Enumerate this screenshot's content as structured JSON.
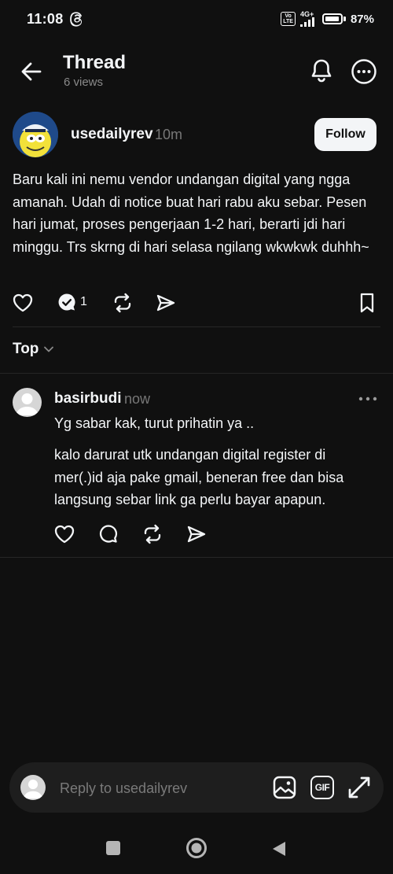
{
  "status_bar": {
    "time": "11:08",
    "volte": "Vo\nLTE",
    "network": "4G+",
    "battery": "87%",
    "battery_level": 0.87
  },
  "header": {
    "title": "Thread",
    "subtitle": "6 views"
  },
  "post": {
    "username": "usedailyrev",
    "time": "10m",
    "follow_label": "Follow",
    "text": "Baru kali ini nemu vendor undangan digital yang ngga amanah. Udah di notice buat hari rabu aku sebar. Pesen hari jumat, proses pengerjaan 1-2 hari, berarti jdi hari minggu. Trs skrng di hari selasa ngilang wkwkwk duhhh~",
    "reply_count": "1"
  },
  "sort": {
    "label": "Top"
  },
  "reply": {
    "username": "basirbudi",
    "time": "now",
    "line1": "Yg sabar kak, turut prihatin ya ..",
    "line2": "kalo darurat utk undangan digital register di mer(.)id aja pake gmail, beneran free dan bisa langsung sebar link ga perlu bayar apapun."
  },
  "composer": {
    "placeholder": "Reply to usedailyrev",
    "gif_label": "GIF"
  },
  "colors": {
    "background": "#101010",
    "text": "#f3f5f7",
    "muted": "#777777",
    "divider": "#262626",
    "button_bg": "#f3f5f7"
  },
  "icons": [
    "back-arrow-icon",
    "bell-icon",
    "more-circle-icon",
    "heart-icon",
    "reply-bubble-icon",
    "repost-icon",
    "share-icon",
    "bookmark-icon",
    "chevron-down-icon",
    "image-icon",
    "expand-icon"
  ]
}
